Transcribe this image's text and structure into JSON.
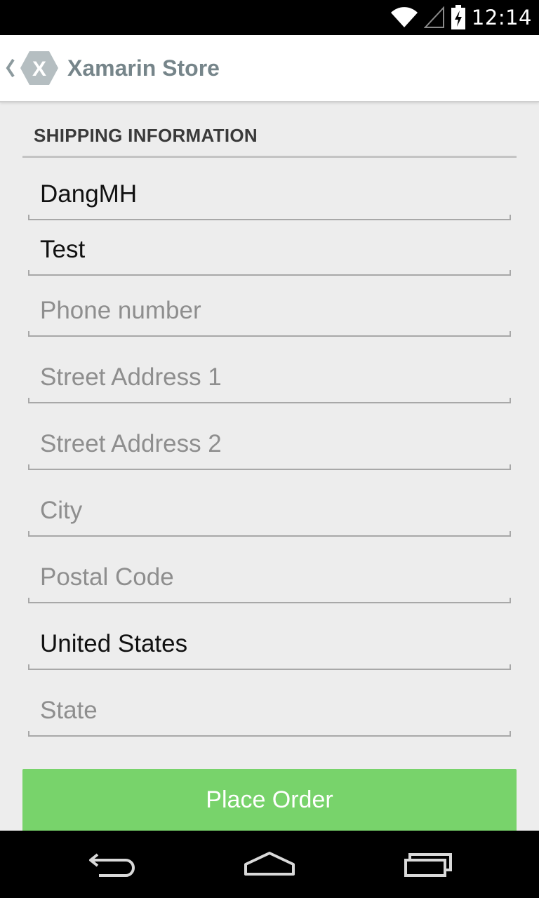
{
  "status_bar": {
    "time": "12:14",
    "icons": [
      "wifi-icon",
      "cell-signal-icon",
      "battery-charging-icon"
    ]
  },
  "action_bar": {
    "title": "Xamarin Store",
    "logo_letter": "X",
    "logo_color": "#b5bec1",
    "title_color": "#76858a"
  },
  "form": {
    "section_title": "SHIPPING INFORMATION",
    "fields": [
      {
        "value": "DangMH",
        "placeholder": ""
      },
      {
        "value": "Test",
        "placeholder": ""
      },
      {
        "value": "",
        "placeholder": "Phone number"
      },
      {
        "value": "",
        "placeholder": "Street Address 1"
      },
      {
        "value": "",
        "placeholder": "Street Address 2"
      },
      {
        "value": "",
        "placeholder": "City"
      },
      {
        "value": "",
        "placeholder": "Postal Code"
      },
      {
        "value": "United States",
        "placeholder": ""
      },
      {
        "value": "",
        "placeholder": "State"
      }
    ],
    "submit_label": "Place Order",
    "submit_color": "#78d36b"
  },
  "nav_bar": {
    "buttons": [
      "back-icon",
      "home-icon",
      "recent-apps-icon"
    ]
  }
}
